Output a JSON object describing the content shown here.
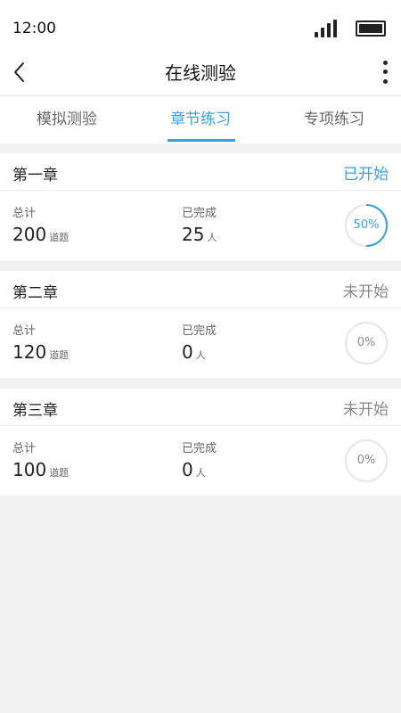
{
  "status_bar": {
    "time": "12:00"
  },
  "header": {
    "title": "在线测验"
  },
  "tabs": [
    {
      "label": "模拟测验",
      "active": false
    },
    {
      "label": "章节练习",
      "active": true
    },
    {
      "label": "专项练习",
      "active": false
    }
  ],
  "colors": {
    "accent": "#3a9ee4",
    "ring_track": "#e6e6e6",
    "muted": "#888888"
  },
  "chapters": [
    {
      "title": "第一章",
      "status": "已开始",
      "total_label": "总计",
      "total": "200",
      "total_unit": "道题",
      "done_label": "已完成",
      "done": "25",
      "done_unit": "人",
      "progress": 50,
      "progress_text": "50%"
    },
    {
      "title": "第二章",
      "status": "未开始",
      "total_label": "总计",
      "total": "120",
      "total_unit": "道题",
      "done_label": "已完成",
      "done": "0",
      "done_unit": "人",
      "progress": 0,
      "progress_text": "0%"
    },
    {
      "title": "第三章",
      "status": "未开始",
      "total_label": "总计",
      "total": "100",
      "total_unit": "道题",
      "done_label": "已完成",
      "done": "0",
      "done_unit": "人",
      "progress": 0,
      "progress_text": "0%"
    }
  ]
}
